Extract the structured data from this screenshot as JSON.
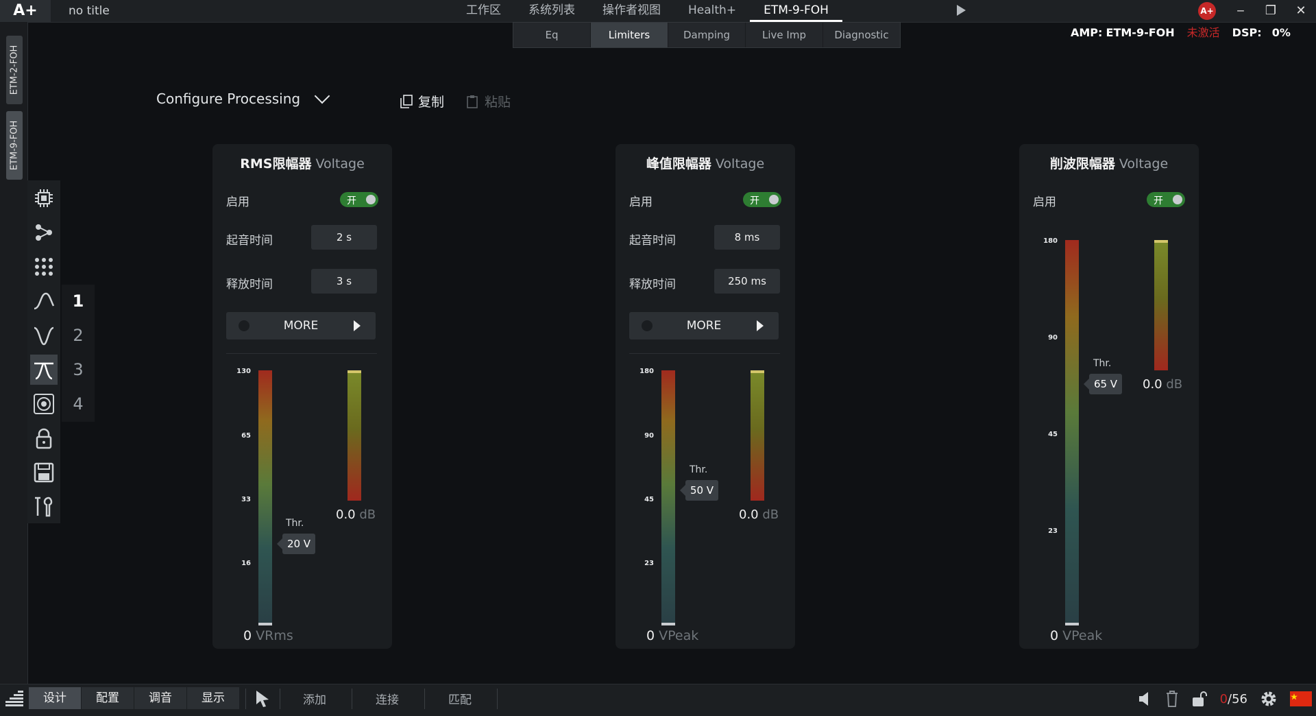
{
  "app": {
    "logo": "A+",
    "doc_title": "no title"
  },
  "main_tabs": [
    {
      "label": "工作区"
    },
    {
      "label": "系统列表"
    },
    {
      "label": "操作者视图"
    },
    {
      "label": "Health+"
    },
    {
      "label": "ETM-9-FOH"
    }
  ],
  "window": {
    "badge": "A+"
  },
  "sub_tabs": [
    {
      "label": "Eq"
    },
    {
      "label": "Limiters"
    },
    {
      "label": "Damping"
    },
    {
      "label": "Live Imp"
    },
    {
      "label": "Diagnostic"
    }
  ],
  "amp_info": {
    "amp_label": "AMP:",
    "amp_name": "ETM-9-FOH",
    "status": "未激活",
    "dsp_label": "DSP:",
    "dsp_value": "0%"
  },
  "devices": [
    {
      "label": "ETM-2-FOH"
    },
    {
      "label": "ETM-9-FOH"
    }
  ],
  "channels": [
    "1",
    "2",
    "3",
    "4"
  ],
  "toolbar": {
    "configure_label": "Configure Processing",
    "copy_label": "复制",
    "paste_label": "粘贴"
  },
  "panels": [
    {
      "title": "RMS限幅器",
      "subtitle": "Voltage",
      "enable_label": "启用",
      "toggle_label": "开",
      "attack_label": "起音时间",
      "attack_value": "2 s",
      "release_label": "释放时间",
      "release_value": "3 s",
      "more_label": "MORE",
      "scale": [
        "130",
        "65",
        "33",
        "16"
      ],
      "thr_label": "Thr.",
      "thr_value": "20 V",
      "thr_fraction": 0.154,
      "db_value": "0.0",
      "db_unit": "dB",
      "bottom_value": "0",
      "bottom_unit": "VRms"
    },
    {
      "title": "峰值限幅器",
      "subtitle": "Voltage",
      "enable_label": "启用",
      "toggle_label": "开",
      "attack_label": "起音时间",
      "attack_value": "8 ms",
      "release_label": "释放时间",
      "release_value": "250 ms",
      "more_label": "MORE",
      "scale": [
        "180",
        "90",
        "45",
        "23"
      ],
      "thr_label": "Thr.",
      "thr_value": "50 V",
      "thr_fraction": 0.278,
      "db_value": "0.0",
      "db_unit": "dB",
      "bottom_value": "0",
      "bottom_unit": "VPeak"
    },
    {
      "title": "削波限幅器",
      "subtitle": "Voltage",
      "enable_label": "启用",
      "toggle_label": "开",
      "scale": [
        "180",
        "90",
        "45",
        "23"
      ],
      "thr_label": "Thr.",
      "thr_value": "65 V",
      "thr_fraction": 0.361,
      "db_value": "0.0",
      "db_unit": "dB",
      "bottom_value": "0",
      "bottom_unit": "VPeak"
    }
  ],
  "bottom_bar": {
    "modes": [
      {
        "label": "设计"
      },
      {
        "label": "配置"
      },
      {
        "label": "调音"
      },
      {
        "label": "显示"
      }
    ],
    "tools": [
      {
        "label": "添加"
      },
      {
        "label": "连接"
      },
      {
        "label": "匹配"
      }
    ],
    "counter_zero": "0",
    "counter_total": "/56"
  }
}
